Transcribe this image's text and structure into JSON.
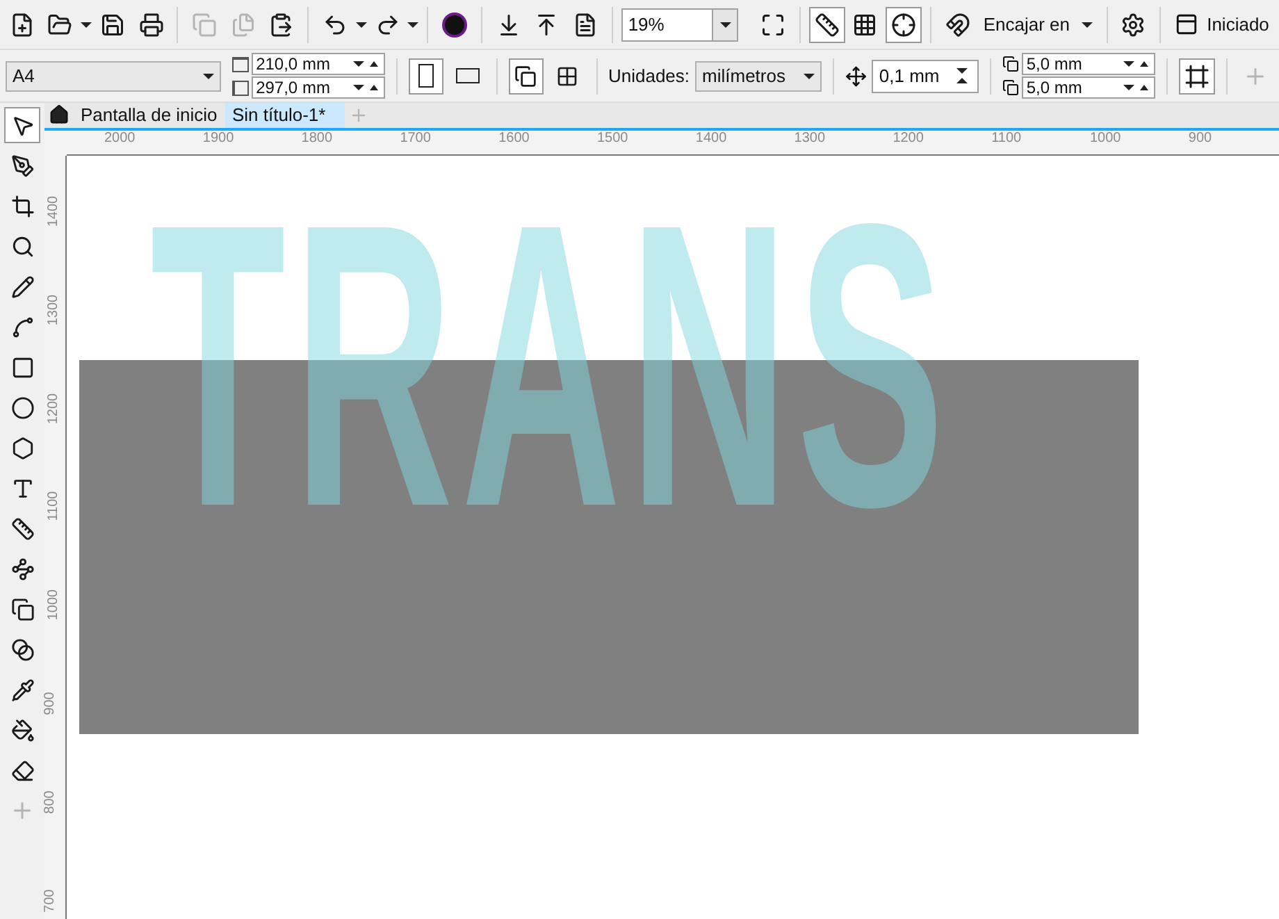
{
  "toolbar": {
    "clipboard": [
      {
        "disabled": true
      },
      {
        "disabled": true
      },
      {
        "disabled": false
      }
    ],
    "zoom": "19%",
    "view_toggles": [
      {
        "on": true
      },
      {
        "on": false
      },
      {
        "on": true
      }
    ],
    "snap_menu": "Encajar en",
    "welcome": "Iniciado"
  },
  "property_bar": {
    "page_size": "A4",
    "width": "210,0 mm",
    "height": "297,0 mm",
    "orientation": [
      {
        "selected": true
      },
      {
        "selected": false
      }
    ],
    "page_toggles": [
      {
        "on": true
      },
      {
        "on": false
      }
    ],
    "units_label": "Unidades:",
    "units": "milímetros",
    "nudge": "0,1 mm",
    "duplicate_x": "5,0 mm",
    "duplicate_y": "5,0 mm"
  },
  "tabs": [
    {
      "label": "Pantalla de inicio",
      "selected": false
    },
    {
      "label": "Sin título-1*",
      "selected": true
    }
  ],
  "toolbox": [
    {
      "kind": "pick",
      "selected": true
    },
    {
      "kind": "shape",
      "selected": false
    },
    {
      "kind": "crop",
      "selected": false
    },
    {
      "kind": "zoom",
      "selected": false
    },
    {
      "kind": "freehand",
      "selected": false
    },
    {
      "kind": "artistic",
      "selected": false
    },
    {
      "kind": "rectangle",
      "selected": false
    },
    {
      "kind": "ellipse",
      "selected": false
    },
    {
      "kind": "polygon",
      "selected": false
    },
    {
      "kind": "text",
      "selected": false
    },
    {
      "kind": "dimension",
      "selected": false
    },
    {
      "kind": "connector",
      "selected": false
    },
    {
      "kind": "shadow",
      "selected": false
    },
    {
      "kind": "transparency",
      "selected": false
    },
    {
      "kind": "eyedropper",
      "selected": false
    },
    {
      "kind": "fill",
      "selected": false
    },
    {
      "kind": "outline",
      "selected": false
    }
  ],
  "rulers": {
    "horizontal": [
      "2000",
      "1900",
      "1800",
      "1700",
      "1600",
      "1500",
      "1400",
      "1300",
      "1200",
      "1100",
      "1000",
      "900"
    ],
    "vertical": [
      "1400",
      "1300",
      "1200",
      "1100",
      "1000",
      "900",
      "800",
      "700"
    ]
  },
  "canvas": {
    "text": "TRANS"
  }
}
